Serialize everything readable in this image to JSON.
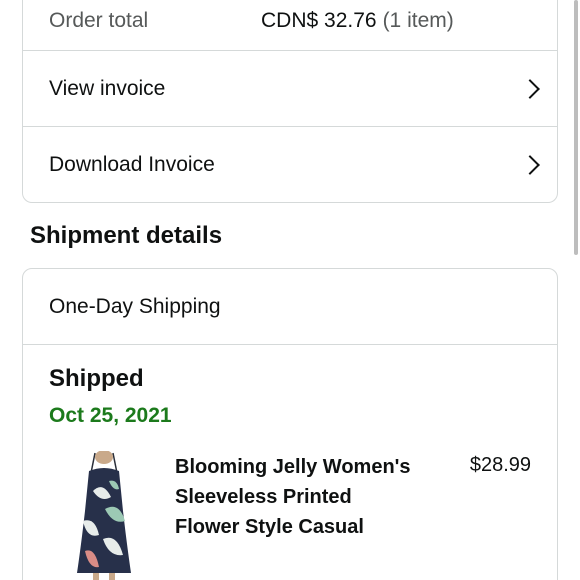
{
  "order": {
    "total_label": "Order total",
    "total_value": "CDN$ 32.76",
    "item_count": "(1 item)",
    "view_invoice_label": "View invoice",
    "download_invoice_label": "Download Invoice"
  },
  "shipment": {
    "section_title": "Shipment details",
    "shipping_method": "One-Day Shipping",
    "status": "Shipped",
    "date": "Oct 25, 2021",
    "item": {
      "title": "Blooming Jelly Women's Sleeveless Printed Flower Style Casual",
      "price": "$28.99"
    }
  },
  "colors": {
    "date_green": "#1c7a1c",
    "border": "#d5d9d9",
    "secondary_text": "#565959"
  },
  "icons": {
    "chevron": "chevron-right-icon"
  }
}
